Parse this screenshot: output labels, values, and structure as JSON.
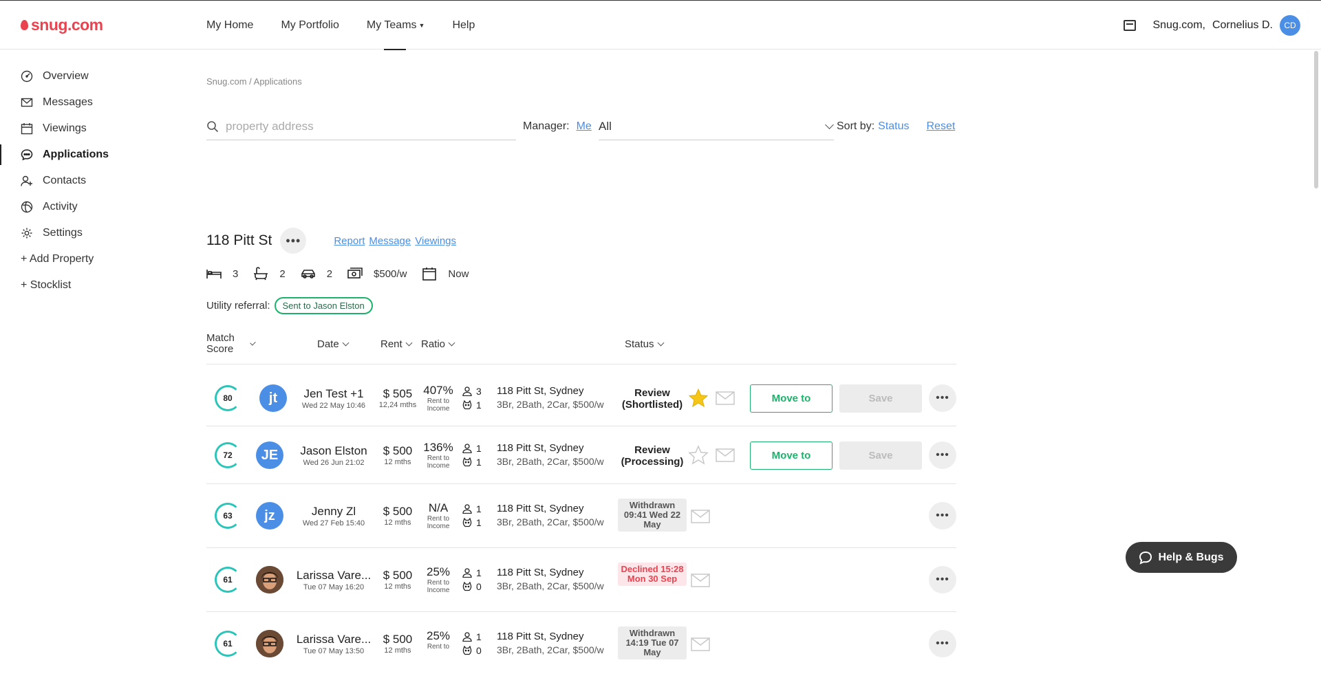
{
  "brand": {
    "logo_text": "snug.com"
  },
  "topnav": {
    "items": [
      {
        "label": "My Home"
      },
      {
        "label": "My Portfolio"
      },
      {
        "label": "My Teams"
      },
      {
        "label": "Help"
      }
    ],
    "agency": "Snug.com,",
    "user": "Cornelius D.",
    "initials": "CD"
  },
  "sidebar": {
    "items": [
      {
        "label": "Overview",
        "icon": "gauge-icon"
      },
      {
        "label": "Messages",
        "icon": "mail-icon"
      },
      {
        "label": "Viewings",
        "icon": "calendar-icon"
      },
      {
        "label": "Applications",
        "icon": "chat-icon"
      },
      {
        "label": "Contacts",
        "icon": "person-add-icon"
      },
      {
        "label": "Activity",
        "icon": "globe-icon"
      },
      {
        "label": "Settings",
        "icon": "gear-icon"
      },
      {
        "label": "+ Add Property"
      },
      {
        "label": "+ Stocklist"
      }
    ]
  },
  "breadcrumb": "Snug.com / Applications",
  "filters": {
    "search_placeholder": "property address",
    "manager_label": "Manager:",
    "manager_me": "Me",
    "manager_value": "All",
    "sort_label": "Sort by:",
    "sort_value": "Status",
    "reset": "Reset"
  },
  "property": {
    "title": "118 Pitt St",
    "links": [
      "Report",
      "Message",
      "Viewings"
    ],
    "beds": "3",
    "baths": "2",
    "cars": "2",
    "rent": "$500/w",
    "available": "Now",
    "utility_label": "Utility referral:",
    "utility_badge": "Sent to Jason Elston"
  },
  "table": {
    "headers": {
      "match_score": "Match Score",
      "date": "Date",
      "rent": "Rent",
      "ratio": "Ratio",
      "status": "Status"
    },
    "rows": [
      {
        "score": "80",
        "initials": "jt",
        "name": "Jen Test +1",
        "date": "Wed 22 May 10:46",
        "rent": "$ 505",
        "term": "12,24 mths",
        "ratio": "407%",
        "ratio_label": "Rent to Income",
        "adults": "3",
        "pets": "1",
        "address": "118 Pitt St, Sydney",
        "specs": "3Br, 2Bath, 2Car, $500/w",
        "status": "Review (Shortlisted)",
        "starred": true,
        "move_label": "Move to",
        "save_label": "Save"
      },
      {
        "score": "72",
        "initials": "JE",
        "name": "Jason Elston",
        "date": "Wed 26 Jun 21:02",
        "rent": "$ 500",
        "term": "12 mths",
        "ratio": "136%",
        "ratio_label": "Rent to Income",
        "adults": "1",
        "pets": "1",
        "address": "118 Pitt St, Sydney",
        "specs": "3Br, 2Bath, 2Car, $500/w",
        "status": "Review (Processing)",
        "starred": false,
        "move_label": "Move to",
        "save_label": "Save"
      },
      {
        "score": "63",
        "initials": "jz",
        "name": "Jenny Zl",
        "date": "Wed 27 Feb 15:40",
        "rent": "$ 500",
        "term": "12 mths",
        "ratio": "N/A",
        "ratio_label": "Rent to Income",
        "adults": "1",
        "pets": "1",
        "address": "118 Pitt St, Sydney",
        "specs": "3Br, 2Bath, 2Car, $500/w",
        "status": "Withdrawn 09:41 Wed 22 May"
      },
      {
        "score": "61",
        "name": "Larissa Vare...",
        "date": "Tue 07 May 16:20",
        "rent": "$ 500",
        "term": "12 mths",
        "ratio": "25%",
        "ratio_label": "Rent to Income",
        "adults": "1",
        "pets": "0",
        "address": "118 Pitt St, Sydney",
        "specs": "3Br, 2Bath, 2Car, $500/w",
        "status": "Declined 15:28 Mon 30 Sep"
      },
      {
        "score": "61",
        "name": "Larissa Vare...",
        "date": "Tue 07 May 13:50",
        "rent": "$ 500",
        "term": "12 mths",
        "ratio": "25%",
        "ratio_label": "Rent to",
        "adults": "1",
        "pets": "0",
        "address": "118 Pitt St, Sydney",
        "specs": "3Br, 2Bath, 2Car, $500/w",
        "status": "Withdrawn 14:19 Tue 07 May"
      }
    ]
  },
  "help_button": "Help & Bugs",
  "colors": {
    "brand": "#e8434f",
    "accent": "#4a8ee6",
    "green": "#1db26b",
    "score_ring": "#2ac5b8"
  }
}
